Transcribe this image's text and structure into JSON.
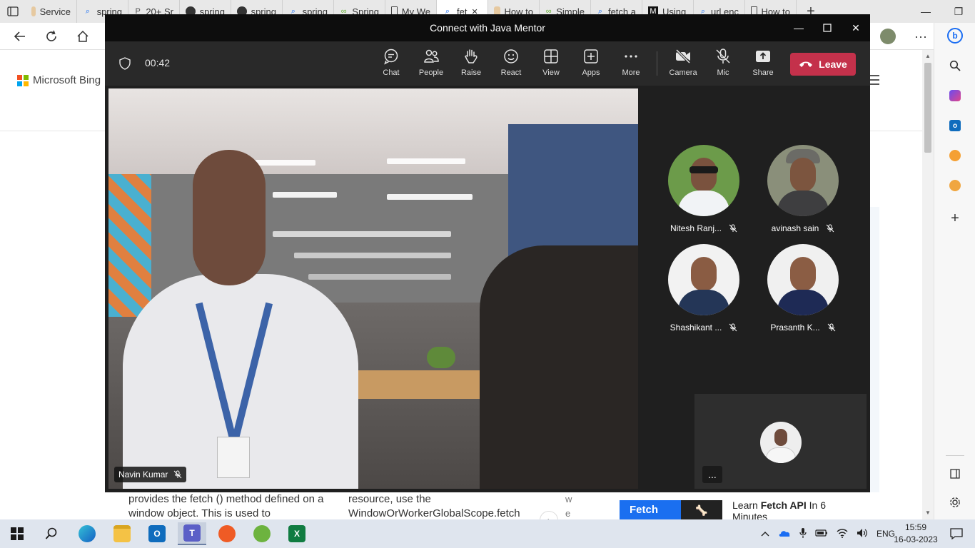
{
  "browser": {
    "tabs": [
      {
        "label": "Service",
        "icon": "page-icon"
      },
      {
        "label": "spring",
        "icon": "search-icon"
      },
      {
        "label": "20+ Sr",
        "icon": "pinterest-icon"
      },
      {
        "label": "spring",
        "icon": "github-icon"
      },
      {
        "label": "spring",
        "icon": "github-icon"
      },
      {
        "label": "spring",
        "icon": "search-icon"
      },
      {
        "label": "Spring",
        "icon": "spring-icon"
      },
      {
        "label": "My We",
        "icon": "doc-icon"
      },
      {
        "label": "fet",
        "icon": "search-icon",
        "active": true
      },
      {
        "label": "How to",
        "icon": "page-icon"
      },
      {
        "label": "Simple",
        "icon": "spring-icon"
      },
      {
        "label": "fetch a",
        "icon": "search-icon"
      },
      {
        "label": "Using",
        "icon": "mdn-icon"
      },
      {
        "label": "url enc",
        "icon": "search-icon"
      },
      {
        "label": "How to",
        "icon": "doc-icon"
      }
    ]
  },
  "bing": {
    "logo_text": "Microsoft Bing",
    "card_a_text": "provides the fetch () method defined on a window object. This is used to",
    "card_b_text": "resource, use the WindowOrWorkerGlobalScope.fetch",
    "card_c_text": "w e",
    "thumb_label": "Fetch",
    "link_prefix": "Learn ",
    "link_bold": "Fetch API",
    "link_suffix": " In 6 Minutes"
  },
  "teams": {
    "title": "Connect with Java Mentor",
    "timer": "00:42",
    "toolbar": {
      "chat": "Chat",
      "people": "People",
      "raise": "Raise",
      "react": "React",
      "view": "View",
      "apps": "Apps",
      "more": "More",
      "camera": "Camera",
      "mic": "Mic",
      "share": "Share",
      "leave": "Leave"
    },
    "main_speaker": "Navin Kumar",
    "participants": [
      {
        "name": "Nitesh Ranj..."
      },
      {
        "name": "avinash sain"
      },
      {
        "name": "Shashikant ..."
      },
      {
        "name": "Prasanth K..."
      }
    ],
    "self_more": "..."
  },
  "taskbar": {
    "language": "ENG",
    "time": "15:59",
    "date": "16-03-2023"
  }
}
